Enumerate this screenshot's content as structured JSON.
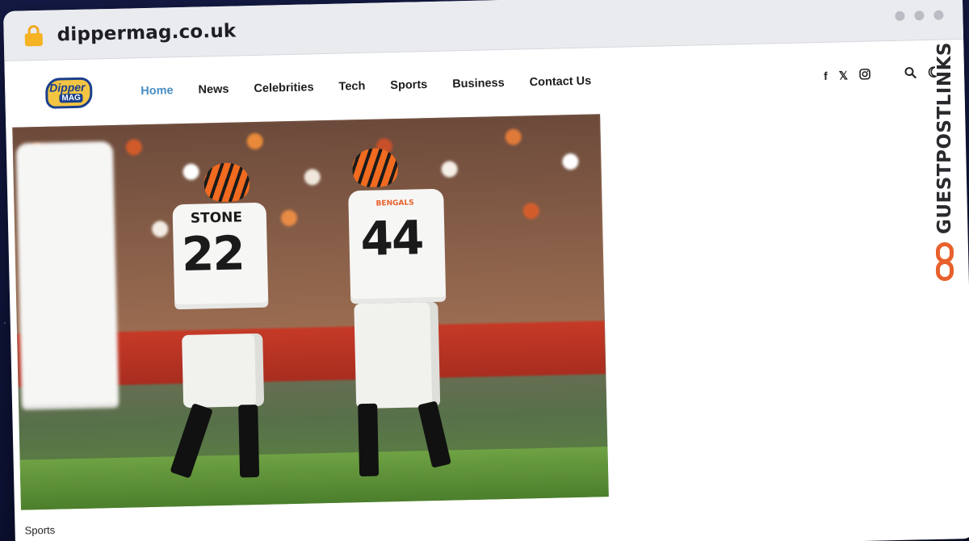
{
  "browser": {
    "url": "dippermag.co.uk"
  },
  "site": {
    "logo_top": "Dipper",
    "logo_bottom": "MAG",
    "nav": [
      {
        "label": "Home",
        "active": true
      },
      {
        "label": "News",
        "active": false
      },
      {
        "label": "Celebrities",
        "active": false
      },
      {
        "label": "Tech",
        "active": false
      },
      {
        "label": "Sports",
        "active": false
      },
      {
        "label": "Business",
        "active": false
      },
      {
        "label": "Contact Us",
        "active": false
      }
    ],
    "header_icons": [
      "facebook-icon",
      "x-icon",
      "instagram-icon",
      "search-icon",
      "moon-icon"
    ],
    "accent_color": "#4a8ec4"
  },
  "hero": {
    "player_left_name": "STONE",
    "player_left_number": "22",
    "player_right_team": "BENGALS",
    "player_right_number": "44"
  },
  "article": {
    "category": "Sports"
  },
  "watermark": {
    "text": "GUESTPOSTLINKS",
    "color": "#e8602c"
  }
}
